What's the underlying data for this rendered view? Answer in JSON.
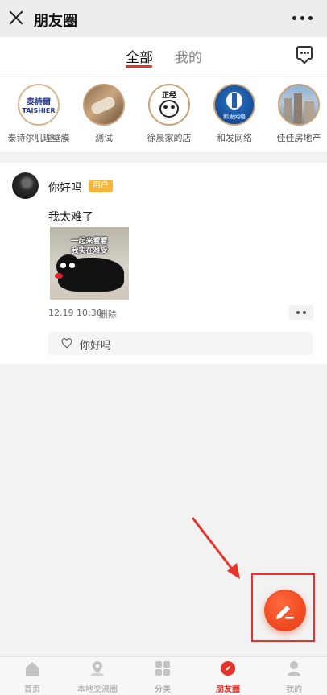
{
  "header": {
    "title": "朋友圈"
  },
  "tabs": [
    {
      "label": "全部",
      "active": true
    },
    {
      "label": "我的",
      "active": false
    }
  ],
  "stores": [
    {
      "label": "泰诗尔肌理壁膜",
      "logo_text_top": "泰詩爾",
      "logo_text_bottom": "TAISHIER"
    },
    {
      "label": "测试"
    },
    {
      "label": "徐晨家的店",
      "logo_text_top": "正经"
    },
    {
      "label": "和发网络",
      "logo_text_bottom": "和发网络"
    },
    {
      "label": "佳佳房地产"
    }
  ],
  "post": {
    "username": "你好吗",
    "badge": "用户",
    "text": "我太难了",
    "image_caption_1": "一起来看看",
    "image_caption_2": "我实在难受",
    "time": "12.19 10:36",
    "delete_label": "删除",
    "likes": [
      "你好吗"
    ]
  },
  "colors": {
    "accent": "#e7332a",
    "fab": "#f04a1f",
    "badge": "#f5b63a"
  },
  "nav": [
    {
      "label": "首页",
      "icon": "home-icon",
      "active": false
    },
    {
      "label": "本地交流圈",
      "icon": "location-icon",
      "active": false
    },
    {
      "label": "分类",
      "icon": "category-grid-icon",
      "active": false
    },
    {
      "label": "朋友圈",
      "icon": "compass-icon",
      "active": true
    },
    {
      "label": "我的",
      "icon": "user-icon",
      "active": false
    }
  ]
}
